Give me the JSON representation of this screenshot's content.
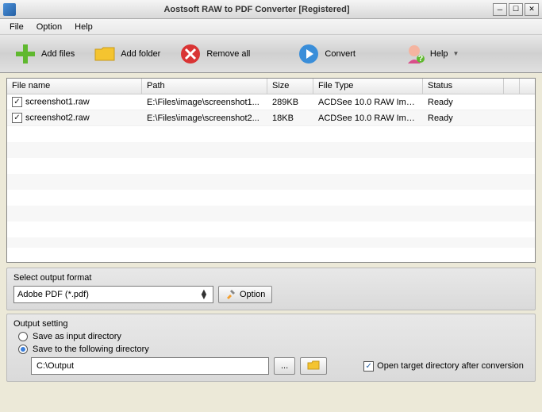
{
  "window": {
    "title": "Aostsoft RAW to PDF Converter [Registered]"
  },
  "menu": {
    "file": "File",
    "option": "Option",
    "help": "Help"
  },
  "toolbar": {
    "add_files": "Add files",
    "add_folder": "Add folder",
    "remove_all": "Remove all",
    "convert": "Convert",
    "help": "Help"
  },
  "columns": {
    "filename": "File name",
    "path": "Path",
    "size": "Size",
    "filetype": "File Type",
    "status": "Status"
  },
  "rows": [
    {
      "checked": true,
      "filename": "screenshot1.raw",
      "path": "E:\\Files\\image\\screenshot1...",
      "size": "289KB",
      "filetype": "ACDSee 10.0 RAW Image",
      "status": "Ready"
    },
    {
      "checked": true,
      "filename": "screenshot2.raw",
      "path": "E:\\Files\\image\\screenshot2...",
      "size": "18KB",
      "filetype": "ACDSee 10.0 RAW Image",
      "status": "Ready"
    }
  ],
  "format": {
    "group_label": "Select output format",
    "selected": "Adobe PDF (*.pdf)",
    "option_btn": "Option"
  },
  "output": {
    "group_label": "Output setting",
    "radio_input_dir": "Save as input directory",
    "radio_following": "Save to the following directory",
    "path": "C:\\Output",
    "browse": "...",
    "open_target": "Open target directory after conversion"
  }
}
